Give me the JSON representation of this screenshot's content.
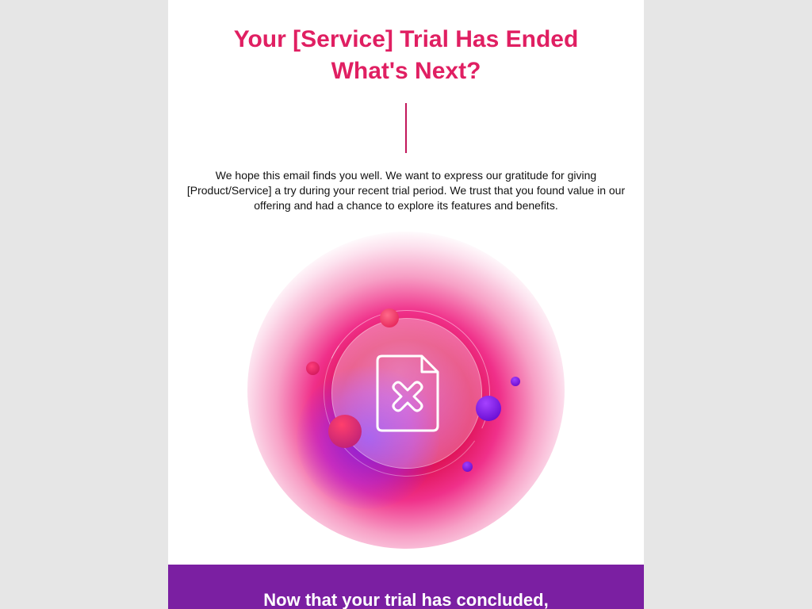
{
  "email": {
    "headline_line1": "Your [Service] Trial Has Ended",
    "headline_line2": "What's Next?",
    "intro_text": "We hope this email finds you well. We want to express our gratitude for giving [Product/Service] a try during your recent trial period. We trust that you found value in our offering and had a chance to explore its features and benefits.",
    "hero_icon": "document-x-icon",
    "band_heading": "Now that your trial has concluded,"
  },
  "colors": {
    "page_background": "#e6e6e6",
    "email_background": "#ffffff",
    "headline": "#e01f62",
    "divider": "#c2185b",
    "band": "#7b1fa2",
    "band_text": "#ffffff"
  }
}
